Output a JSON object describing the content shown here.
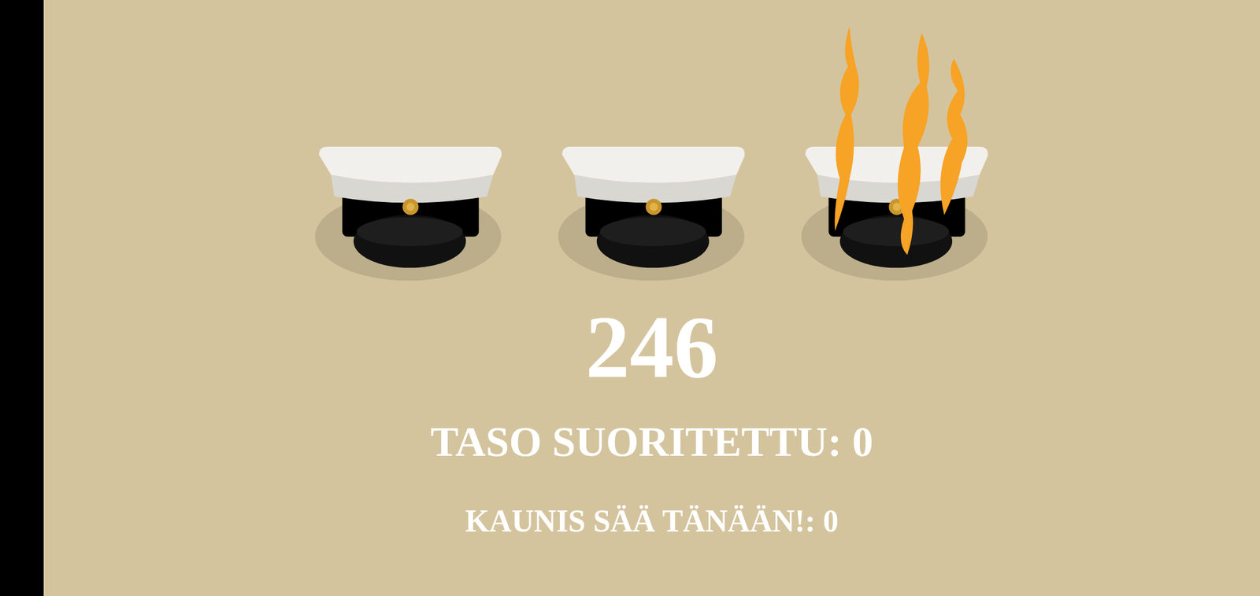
{
  "caps": [
    {
      "burning": false
    },
    {
      "burning": false
    },
    {
      "burning": true
    }
  ],
  "score": "246",
  "level_completed": "TASO SUORITETTU: 0",
  "weather": "KAUNIS SÄÄ TÄNÄÄN!: 0"
}
